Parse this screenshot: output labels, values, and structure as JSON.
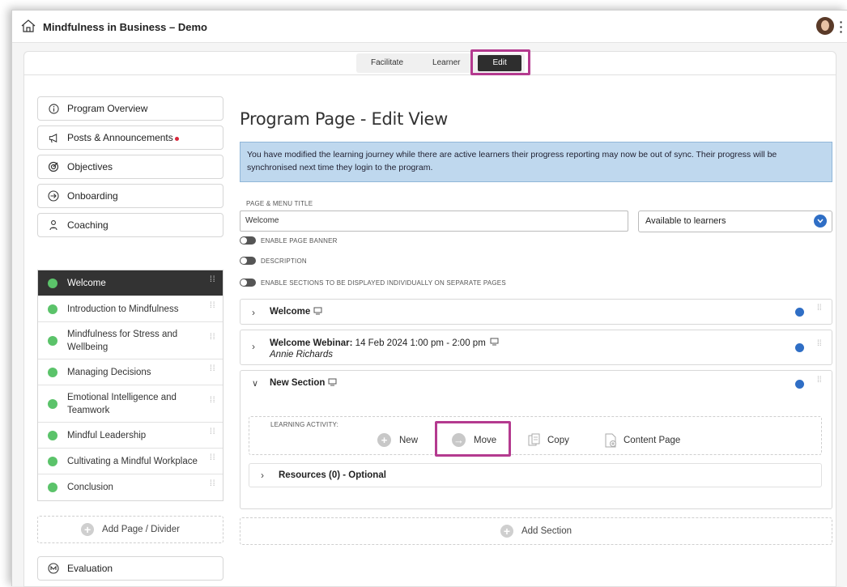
{
  "app": {
    "title": "Mindfulness in Business – Demo"
  },
  "modes": [
    {
      "label": "Facilitate"
    },
    {
      "label": "Learner"
    },
    {
      "label": "Edit"
    }
  ],
  "sidebar": {
    "nav": [
      {
        "label": "Program Overview",
        "icon": "info-icon"
      },
      {
        "label": "Posts & Announcements",
        "icon": "megaphone-icon",
        "badge": "unread-dot"
      },
      {
        "label": "Objectives",
        "icon": "target-icon"
      },
      {
        "label": "Onboarding",
        "icon": "arrow-in-circle-icon"
      },
      {
        "label": "Coaching",
        "icon": "people-icon"
      }
    ],
    "pages": [
      {
        "label": "Welcome",
        "active": true
      },
      {
        "label": "Introduction to Mindfulness"
      },
      {
        "label": "Mindfulness for Stress and Wellbeing"
      },
      {
        "label": "Managing Decisions"
      },
      {
        "label": "Emotional Intelligence and Teamwork"
      },
      {
        "label": "Mindful Leadership"
      },
      {
        "label": "Cultivating a Mindful Workplace"
      },
      {
        "label": "Conclusion"
      }
    ],
    "add_page_label": "Add Page / Divider",
    "evaluation_label": "Evaluation"
  },
  "main": {
    "title": "Program Page - Edit View",
    "alert": "You have modified the learning journey while there are active learners their progress reporting may now be out of sync. Their progress will be synchronised next time they login to the program.",
    "title_field_label": "PAGE & MENU TITLE",
    "title_field_value": "Welcome",
    "availability": "Available to learners",
    "toggles": [
      {
        "label": "ENABLE PAGE BANNER"
      },
      {
        "label": "DESCRIPTION"
      },
      {
        "label": "ENABLE SECTIONS TO BE DISPLAYED INDIVIDUALLY ON SEPARATE PAGES"
      }
    ],
    "sections": [
      {
        "title": "Welcome"
      },
      {
        "title": "Welcome Webinar:",
        "detail": "14 Feb 2024 1:00 pm - 2:00 pm",
        "presenter": "Annie Richards"
      },
      {
        "title": "New Section"
      }
    ],
    "learning_activity": {
      "label": "LEARNING ACTIVITY:",
      "new": "New",
      "move": "Move",
      "copy": "Copy",
      "content_page": "Content Page"
    },
    "resources_label": "Resources (0) - Optional",
    "add_section_label": "Add Section"
  },
  "colors": {
    "accent": "#2f6ec5",
    "highlight": "#b43a8f",
    "page_status": "#5bc36a",
    "alert_bg": "#bfd8ee",
    "badge": "#d9283c"
  }
}
